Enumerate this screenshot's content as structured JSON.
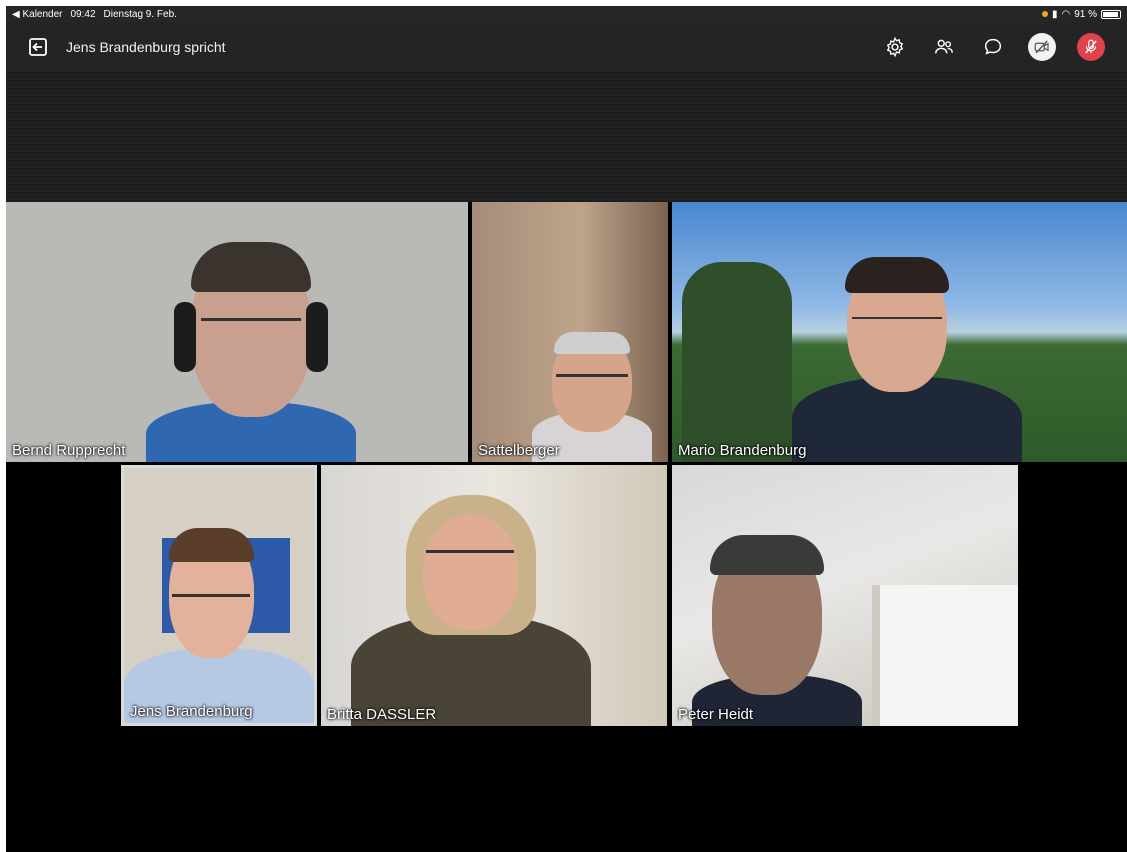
{
  "status_bar": {
    "back_app": "◀ Kalender",
    "time": "09:42",
    "date": "Dienstag 9. Feb.",
    "battery": "91 %",
    "battery_level": 0.91
  },
  "toolbar": {
    "speaker_text": "Jens Brandenburg spricht",
    "icons": [
      "leave-icon",
      "settings-icon",
      "participants-icon",
      "chat-icon",
      "camera-off-icon",
      "mic-off-icon"
    ]
  },
  "participants": [
    {
      "name": "Bernd Rupprecht"
    },
    {
      "name": "Sattelberger"
    },
    {
      "name": "Mario Brandenburg"
    },
    {
      "name": "Jens Brandenburg"
    },
    {
      "name": "Britta DASSLER"
    },
    {
      "name": "Peter Heidt"
    }
  ],
  "colors": {
    "mic_off": "#e0434c",
    "active_speaker_border": "#d9d9d9"
  }
}
